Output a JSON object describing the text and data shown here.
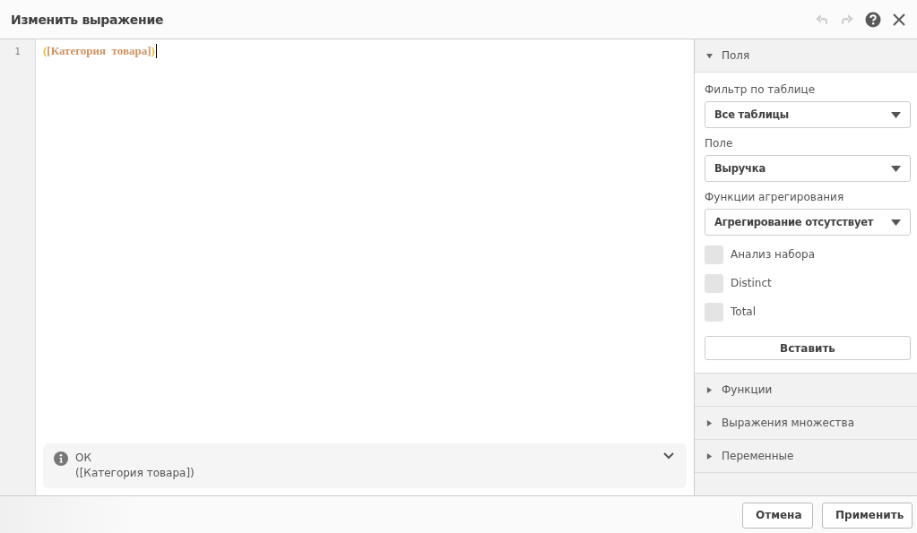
{
  "window": {
    "title": "Изменить выражение"
  },
  "toolbar": {
    "undo": {
      "disabled": true
    },
    "redo": {
      "disabled": true
    }
  },
  "editor": {
    "line_numbers": [
      "1"
    ],
    "tokens": [
      {
        "text": "(",
        "kind": "paren"
      },
      {
        "text": "[Категория  товара]",
        "kind": "field"
      },
      {
        "text": ")",
        "kind": "paren"
      }
    ]
  },
  "status": {
    "title": "ОК",
    "expression": "([Категория товара])",
    "expanded": false
  },
  "panel": {
    "sections": [
      {
        "title": "Поля",
        "expanded": true
      },
      {
        "title": "Функции",
        "expanded": false
      },
      {
        "title": "Выражения множества",
        "expanded": false
      },
      {
        "title": "Переменные",
        "expanded": false
      }
    ],
    "dropdowns": [
      {
        "label": "Фильтр по таблице",
        "value": "Все таблицы"
      },
      {
        "label": "Поле",
        "value": "Выручка"
      },
      {
        "label": "Функции агрегирования",
        "value": "Агрегирование отсутствует"
      }
    ],
    "checkboxes": [
      {
        "label": "Анализ набора",
        "checked": false
      },
      {
        "label": "Distinct",
        "checked": false
      },
      {
        "label": "Total",
        "checked": false
      }
    ],
    "insert_button": "Вставить"
  },
  "buttons": [
    "Отмена",
    "Применить"
  ]
}
